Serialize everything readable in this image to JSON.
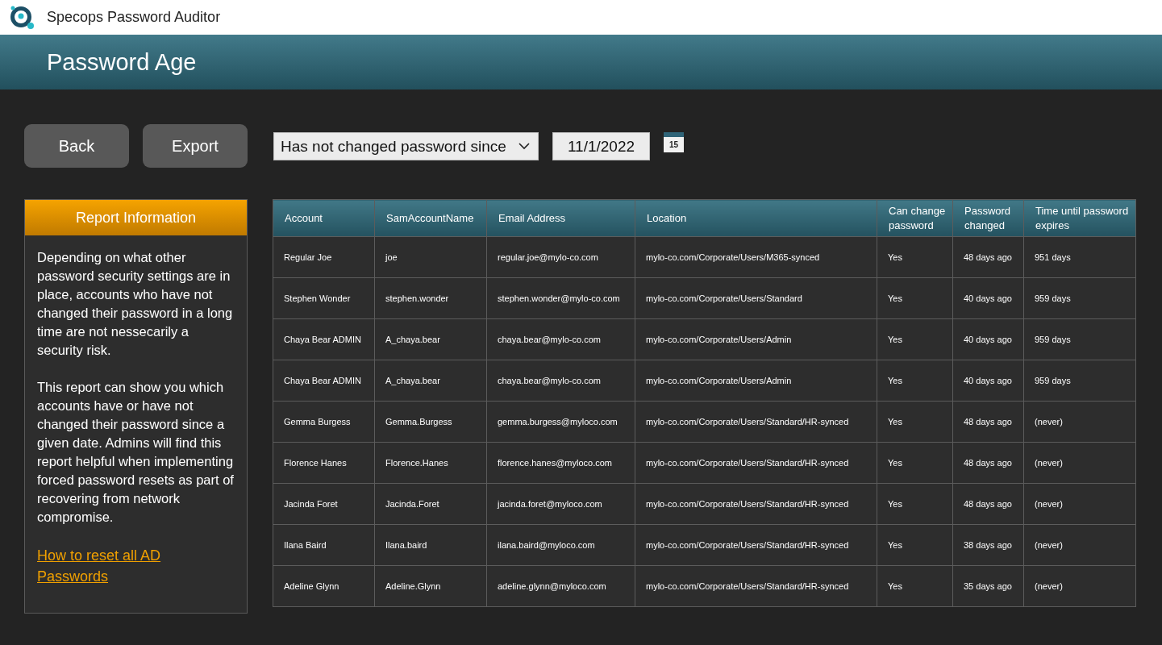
{
  "window": {
    "title": "Specops Password Auditor"
  },
  "page_title": "Password Age",
  "toolbar": {
    "buttons": [
      "Back",
      "Export"
    ],
    "filter_dropdown": {
      "value": "Has not changed password since"
    },
    "date_field": {
      "value": "11/1/2022"
    },
    "calendar_button": {
      "day": "15"
    }
  },
  "report_information": {
    "title": "Report Information",
    "paragraphs": [
      "Depending on what other password security settings are in place, accounts who have not changed their password in a long time are not nessecarily a security risk.",
      "This report can show you which accounts have or have not changed their password since a given date. Admins will find this report helpful when implementing forced password resets as part of recovering from network compromise."
    ],
    "link": "How to reset all AD Passwords"
  },
  "table": {
    "columns": [
      "Account",
      "SamAccountName",
      "Email Address",
      "Location",
      "Can change password",
      "Password changed",
      "Time until password expires"
    ],
    "rows": [
      [
        "Regular Joe",
        "joe",
        "regular.joe@mylo-co.com",
        "mylo-co.com/Corporate/Users/M365-synced",
        "Yes",
        "48 days ago",
        "951 days"
      ],
      [
        "Stephen Wonder",
        "stephen.wonder",
        "stephen.wonder@mylo-co.com",
        "mylo-co.com/Corporate/Users/Standard",
        "Yes",
        "40 days ago",
        "959 days"
      ],
      [
        "Chaya Bear ADMIN",
        "A_chaya.bear",
        "chaya.bear@mylo-co.com",
        "mylo-co.com/Corporate/Users/Admin",
        "Yes",
        "40 days ago",
        "959 days"
      ],
      [
        "Chaya Bear ADMIN",
        "A_chaya.bear",
        "chaya.bear@mylo-co.com",
        "mylo-co.com/Corporate/Users/Admin",
        "Yes",
        "40 days ago",
        "959 days"
      ],
      [
        "Gemma Burgess",
        "Gemma.Burgess",
        "gemma.burgess@myloco.com",
        "mylo-co.com/Corporate/Users/Standard/HR-synced",
        "Yes",
        "48 days ago",
        "(never)"
      ],
      [
        "Florence Hanes",
        "Florence.Hanes",
        "florence.hanes@myloco.com",
        "mylo-co.com/Corporate/Users/Standard/HR-synced",
        "Yes",
        "48 days ago",
        "(never)"
      ],
      [
        "Jacinda Foret",
        "Jacinda.Foret",
        "jacinda.foret@myloco.com",
        "mylo-co.com/Corporate/Users/Standard/HR-synced",
        "Yes",
        "48 days ago",
        "(never)"
      ],
      [
        "Ilana Baird",
        "Ilana.baird",
        "ilana.baird@myloco.com",
        "mylo-co.com/Corporate/Users/Standard/HR-synced",
        "Yes",
        "38 days ago",
        "(never)"
      ],
      [
        "Adeline Glynn",
        "Adeline.Glynn",
        "adeline.glynn@myloco.com",
        "mylo-co.com/Corporate/Users/Standard/HR-synced",
        "Yes",
        "35 days ago",
        "(never)"
      ]
    ]
  }
}
